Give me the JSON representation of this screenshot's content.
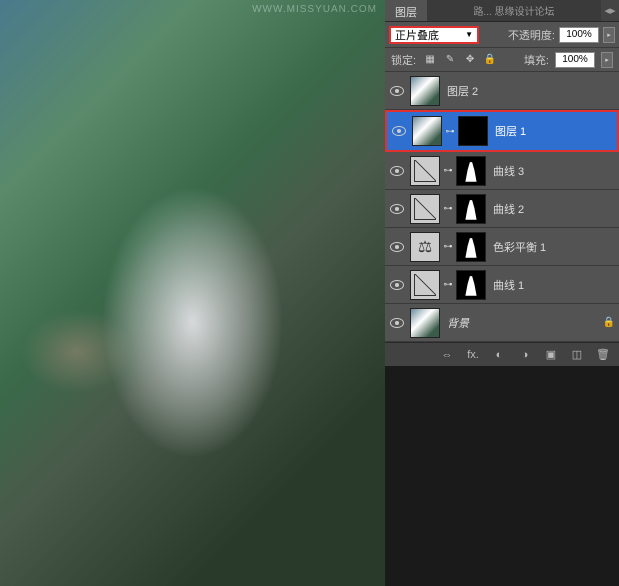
{
  "watermark": "WWW.MISSYUAN.COM",
  "panel": {
    "tabs": {
      "layers": "图层",
      "channels_paths": "路... 思缘设计论坛"
    },
    "blend_mode": "正片叠底",
    "opacity_label": "不透明度:",
    "opacity_value": "100%",
    "lock_label": "锁定:",
    "fill_label": "填充:",
    "fill_value": "100%"
  },
  "layers": [
    {
      "name": "图层 2",
      "type": "image",
      "selected": false,
      "mask": false
    },
    {
      "name": "图层 1",
      "type": "image",
      "selected": true,
      "mask": true
    },
    {
      "name": "曲线 3",
      "type": "curves",
      "selected": false,
      "mask": true
    },
    {
      "name": "曲线 2",
      "type": "curves",
      "selected": false,
      "mask": true
    },
    {
      "name": "色彩平衡 1",
      "type": "balance",
      "selected": false,
      "mask": true
    },
    {
      "name": "曲线 1",
      "type": "curves",
      "selected": false,
      "mask": true
    },
    {
      "name": "背景",
      "type": "bg",
      "selected": false,
      "mask": false
    }
  ],
  "footer_icons": [
    "link",
    "fx",
    "mask",
    "adjust",
    "group",
    "new",
    "trash"
  ]
}
